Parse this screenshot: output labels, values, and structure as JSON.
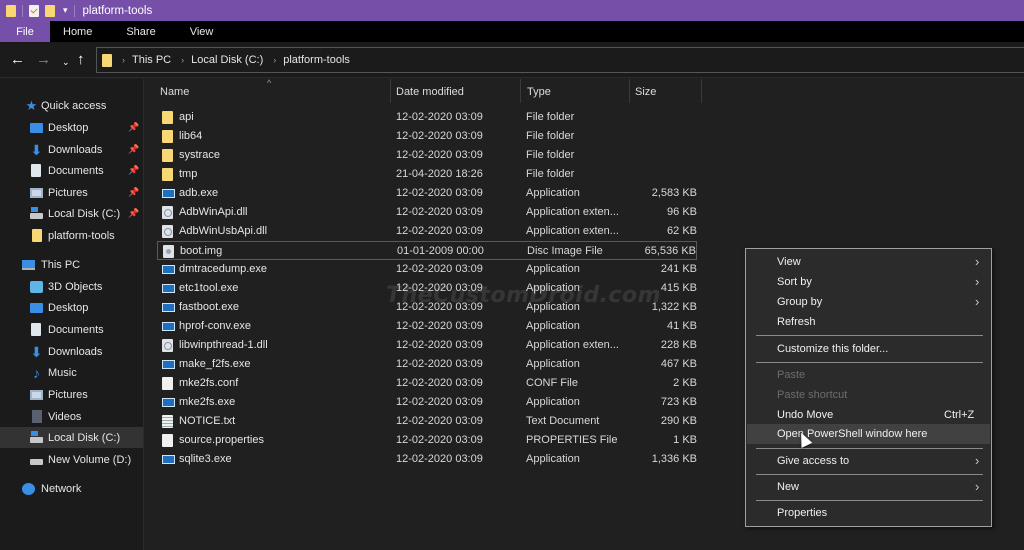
{
  "window": {
    "title": "platform-tools",
    "qat_icons": [
      "folder-icon",
      "properties-icon",
      "new-folder-icon",
      "customize-dropdown-icon"
    ]
  },
  "ribbon": {
    "tabs": [
      "File",
      "Home",
      "Share",
      "View"
    ]
  },
  "nav": {
    "back_icon": "←",
    "forward_icon": "→",
    "recent_icon": "⌄",
    "up_icon": "↑",
    "breadcrumb": [
      "This PC",
      "Local Disk (C:)",
      "platform-tools"
    ],
    "crumb_sep": "›"
  },
  "sidebar": {
    "quick_access": {
      "label": "Quick access",
      "items": [
        {
          "label": "Desktop",
          "icon": "desktop-icon",
          "pinned": true
        },
        {
          "label": "Downloads",
          "icon": "downloads-icon",
          "pinned": true
        },
        {
          "label": "Documents",
          "icon": "documents-icon",
          "pinned": true
        },
        {
          "label": "Pictures",
          "icon": "pictures-icon",
          "pinned": true
        },
        {
          "label": "Local Disk (C:)",
          "icon": "local-disk-icon",
          "pinned": true
        },
        {
          "label": "platform-tools",
          "icon": "folder-icon",
          "pinned": false
        }
      ]
    },
    "this_pc": {
      "label": "This PC",
      "items": [
        {
          "label": "3D Objects",
          "icon": "3d-objects-icon"
        },
        {
          "label": "Desktop",
          "icon": "desktop-icon"
        },
        {
          "label": "Documents",
          "icon": "documents-icon"
        },
        {
          "label": "Downloads",
          "icon": "downloads-icon"
        },
        {
          "label": "Music",
          "icon": "music-icon"
        },
        {
          "label": "Pictures",
          "icon": "pictures-icon"
        },
        {
          "label": "Videos",
          "icon": "videos-icon"
        },
        {
          "label": "Local Disk (C:)",
          "icon": "local-disk-icon",
          "selected": true
        },
        {
          "label": "New Volume (D:)",
          "icon": "drive-icon"
        }
      ]
    },
    "network": {
      "label": "Network"
    },
    "pin_glyph": "📌",
    "star_glyph": "★",
    "download_glyph": "⬇",
    "music_glyph": "♪"
  },
  "columns": {
    "name": "Name",
    "date": "Date modified",
    "type": "Type",
    "size": "Size",
    "sort_indicator": "^"
  },
  "files": [
    {
      "name": "api",
      "date": "12-02-2020 03:09",
      "type": "File folder",
      "size": "",
      "icon": "folder"
    },
    {
      "name": "lib64",
      "date": "12-02-2020 03:09",
      "type": "File folder",
      "size": "",
      "icon": "folder"
    },
    {
      "name": "systrace",
      "date": "12-02-2020 03:09",
      "type": "File folder",
      "size": "",
      "icon": "folder"
    },
    {
      "name": "tmp",
      "date": "21-04-2020 18:26",
      "type": "File folder",
      "size": "",
      "icon": "folder"
    },
    {
      "name": "adb.exe",
      "date": "12-02-2020 03:09",
      "type": "Application",
      "size": "2,583 KB",
      "icon": "exe"
    },
    {
      "name": "AdbWinApi.dll",
      "date": "12-02-2020 03:09",
      "type": "Application exten...",
      "size": "96 KB",
      "icon": "dll"
    },
    {
      "name": "AdbWinUsbApi.dll",
      "date": "12-02-2020 03:09",
      "type": "Application exten...",
      "size": "62 KB",
      "icon": "dll"
    },
    {
      "name": "boot.img",
      "date": "01-01-2009 00:00",
      "type": "Disc Image File",
      "size": "65,536 KB",
      "icon": "img",
      "focused": true
    },
    {
      "name": "dmtracedump.exe",
      "date": "12-02-2020 03:09",
      "type": "Application",
      "size": "241 KB",
      "icon": "exe"
    },
    {
      "name": "etc1tool.exe",
      "date": "12-02-2020 03:09",
      "type": "Application",
      "size": "415 KB",
      "icon": "exe"
    },
    {
      "name": "fastboot.exe",
      "date": "12-02-2020 03:09",
      "type": "Application",
      "size": "1,322 KB",
      "icon": "exe"
    },
    {
      "name": "hprof-conv.exe",
      "date": "12-02-2020 03:09",
      "type": "Application",
      "size": "41 KB",
      "icon": "exe"
    },
    {
      "name": "libwinpthread-1.dll",
      "date": "12-02-2020 03:09",
      "type": "Application exten...",
      "size": "228 KB",
      "icon": "dll"
    },
    {
      "name": "make_f2fs.exe",
      "date": "12-02-2020 03:09",
      "type": "Application",
      "size": "467 KB",
      "icon": "exe"
    },
    {
      "name": "mke2fs.conf",
      "date": "12-02-2020 03:09",
      "type": "CONF File",
      "size": "2 KB",
      "icon": "file"
    },
    {
      "name": "mke2fs.exe",
      "date": "12-02-2020 03:09",
      "type": "Application",
      "size": "723 KB",
      "icon": "exe"
    },
    {
      "name": "NOTICE.txt",
      "date": "12-02-2020 03:09",
      "type": "Text Document",
      "size": "290 KB",
      "icon": "txt"
    },
    {
      "name": "source.properties",
      "date": "12-02-2020 03:09",
      "type": "PROPERTIES File",
      "size": "1 KB",
      "icon": "file"
    },
    {
      "name": "sqlite3.exe",
      "date": "12-02-2020 03:09",
      "type": "Application",
      "size": "1,336 KB",
      "icon": "exe"
    }
  ],
  "watermark": "TheCustomDroid.com",
  "context_menu": {
    "arrow_glyph": "›",
    "items": [
      {
        "label": "View",
        "submenu": true
      },
      {
        "label": "Sort by",
        "submenu": true
      },
      {
        "label": "Group by",
        "submenu": true
      },
      {
        "label": "Refresh"
      },
      {
        "separator": true
      },
      {
        "label": "Customize this folder..."
      },
      {
        "separator": true
      },
      {
        "label": "Paste",
        "disabled": true
      },
      {
        "label": "Paste shortcut",
        "disabled": true
      },
      {
        "label": "Undo Move",
        "shortcut": "Ctrl+Z"
      },
      {
        "label": "Open PowerShell window here",
        "hover": true
      },
      {
        "separator": true
      },
      {
        "label": "Give access to",
        "submenu": true
      },
      {
        "separator": true
      },
      {
        "label": "New",
        "submenu": true
      },
      {
        "separator": true
      },
      {
        "label": "Properties"
      }
    ]
  },
  "colors": {
    "accent": "#7650a8",
    "folder": "#f8d775",
    "icon_blue": "#3a8ee6",
    "background": "#202020",
    "sidebar_bg": "#1b1b1b",
    "menu_bg": "#2b2b2b"
  }
}
